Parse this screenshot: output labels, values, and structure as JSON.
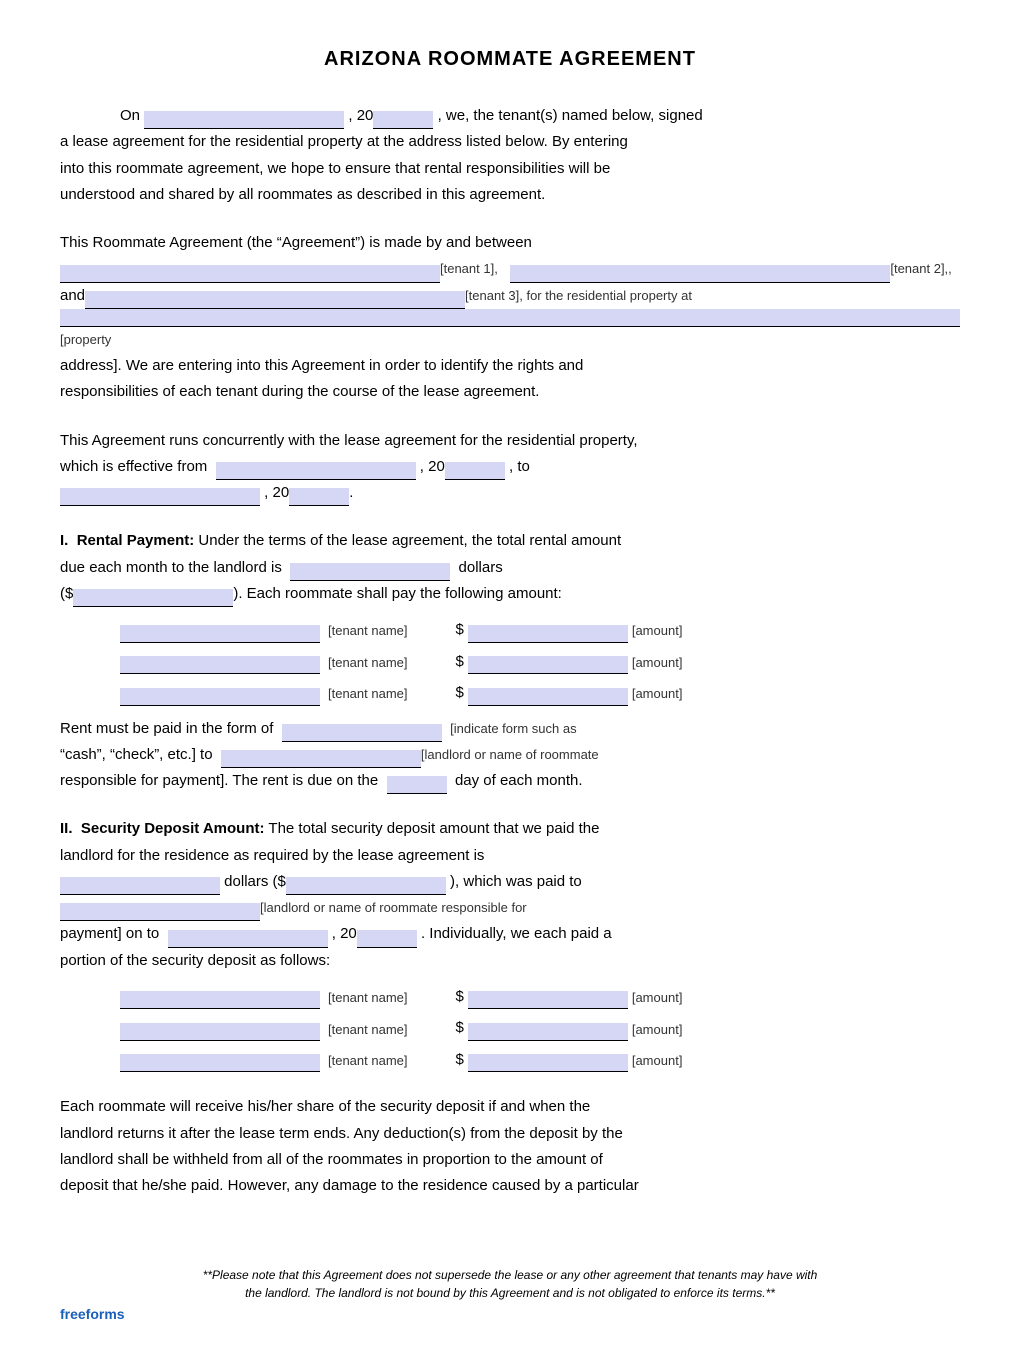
{
  "title": "ARIZONA ROOMMATE AGREEMENT",
  "intro": {
    "line1_pre": "On",
    "line1_mid": ", 20",
    "line1_post": ", we, the tenant(s) named below, signed",
    "line2": "a lease agreement for the residential property at the address listed below. By entering",
    "line3": "into this roommate agreement, we hope to ensure that rental responsibilities will be",
    "line4": "understood and shared by all roommates as described in this agreement."
  },
  "agreement_parties": {
    "pre": "This Roommate Agreement (the “Agreement”) is made by and between",
    "tenant1_label": "[tenant 1],",
    "tenant2_label": "[tenant 2],,",
    "and_label": "and",
    "tenant3_label": "[tenant 3], for the residential property at",
    "property_label": "[property",
    "post": "address]. We are entering into this Agreement in order to identify the rights and",
    "post2": "responsibilities of each tenant during the course of the lease agreement."
  },
  "concurrent": {
    "pre": "This Agreement runs concurrently with the lease agreement for the residential property,",
    "which_from": "which is effective from",
    "mid": ", 20",
    "to": ", to",
    "end": ", 20"
  },
  "section1": {
    "heading": "I.",
    "title": "Rental Payment:",
    "text1": "Under the terms of the lease agreement, the total rental amount",
    "text2": "due each month to the landlord is",
    "text3": "dollars",
    "text4": "($",
    "text5": ").  Each roommate shall pay the following amount:",
    "tenants": [
      {
        "name_label": "[tenant name]",
        "amount_pre": "$",
        "amount_label": "[amount]"
      },
      {
        "name_label": "[tenant name]",
        "amount_pre": "$",
        "amount_label": "[amount]"
      },
      {
        "name_label": "[tenant name]",
        "amount_pre": "$",
        "amount_label": "[amount]"
      }
    ],
    "rent_form_pre": "Rent must be paid in the form of",
    "rent_form_label": "[indicate form such as",
    "cash_check": "“cash”, “check”, etc.] to",
    "landlord_label": "[landlord or name of roommate",
    "responsible": "responsible for payment]. The rent is due on the",
    "day_label": "____",
    "day_post": "day of each month."
  },
  "section2": {
    "heading": "II.",
    "title": "Security Deposit Amount:",
    "text1": "The total security deposit amount that we paid the",
    "text2": "landlord for the residence as required by the lease agreement is",
    "dollars_label": "dollars ($",
    "paid_to": "), which was paid to",
    "landlord_label": "[landlord or name of roommate responsible for",
    "payment_label": "payment] on to",
    "date_mid": ", 20",
    "date_post": ". Individually, we each paid a",
    "portion": "portion of the security deposit as follows:",
    "tenants": [
      {
        "name_label": "[tenant name]",
        "amount_pre": "$",
        "amount_label": "[amount]"
      },
      {
        "name_label": "[tenant name]",
        "amount_pre": "$",
        "amount_label": "[amount]"
      },
      {
        "name_label": "[tenant name]",
        "amount_pre": "$",
        "amount_label": "[amount]"
      }
    ]
  },
  "final_para": {
    "line1": "Each roommate will receive his/her share of the security deposit if and when the",
    "line2": "landlord returns it after the lease term ends. Any deduction(s) from the deposit by the",
    "line3": "landlord shall be withheld from all of the roommates in proportion to the amount of",
    "line4": "deposit that he/she paid. However, any damage to the residence caused by a particular"
  },
  "footer": {
    "note1": "**Please note that this Agreement does not supersede the lease or any other agreement that tenants may have with",
    "note2": "the landlord. The landlord is not bound by this Agreement and is not obligated to enforce its terms.**",
    "brand": "freeforms"
  }
}
